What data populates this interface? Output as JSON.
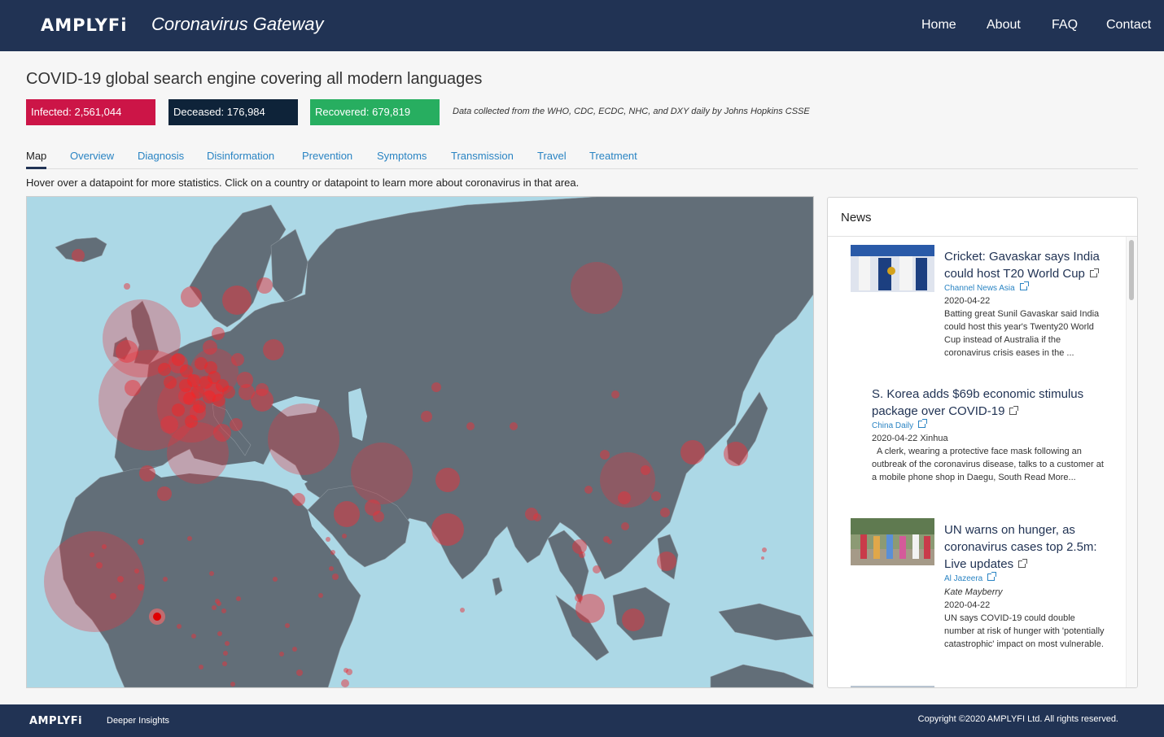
{
  "header": {
    "logo": "AMPLYFi",
    "title": "Coronavirus Gateway",
    "nav": [
      "Home",
      "About",
      "FAQ",
      "Contact"
    ]
  },
  "page_title": "COVID-19 global search engine covering all modern languages",
  "stats": {
    "infected": "Infected: 2,561,044",
    "deceased": "Deceased: 176,984",
    "recovered": "Recovered: 679,819",
    "note": "Data collected from the WHO, CDC, ECDC, NHC, and DXY daily by Johns Hopkins CSSE"
  },
  "tabs": [
    "Map",
    "Overview",
    "Diagnosis",
    "Disinformation",
    "Prevention",
    "Symptoms",
    "Transmission",
    "Travel",
    "Treatment"
  ],
  "active_tab": "Map",
  "hint": "Hover over a datapoint for more statistics. Click on a country or datapoint to learn more about coronavirus in that area.",
  "colors": {
    "header": "#213354",
    "infected": "#cc1547",
    "deceased": "#0e2339",
    "recovered": "#27ae60",
    "ocean": "#acd8e6",
    "land": "#626e78",
    "bubble": "#e8323a",
    "link": "#2a84c3"
  },
  "news": {
    "heading": "News",
    "items": [
      {
        "title": "Cricket: Gavaskar says India could host T20 World Cup",
        "source": "Channel News Asia",
        "date": "2020-04-22",
        "body": "Batting great Sunil Gavaskar said India could host this year's Twenty20 World Cup instead of Australia if the coronavirus crisis eases in the ..."
      },
      {
        "title": "S. Korea adds $69b economic stimulus package over COVID-19",
        "source": "China Daily",
        "date": "2020-04-22 Xinhua",
        "body": "A clerk, wearing a protective face mask following an outbreak of the coronavirus disease, talks to a customer at a mobile phone shop in Daegu, South  Read More..."
      },
      {
        "title": "UN warns on hunger, as coronavirus cases top 2.5m: Live updates",
        "source": "Al Jazeera",
        "author": "Kate Mayberry",
        "date": "2020-04-22",
        "body": "UN says COVID-19 could double number at risk of hunger with 'potentially catastrophic' impact on most vulnerable."
      }
    ]
  },
  "footer": {
    "logo": "AMPLYFi",
    "tagline": "Deeper Insights",
    "copyright": "Copyright ©2020 AMPLYFI Ltd. All rights reserved."
  }
}
